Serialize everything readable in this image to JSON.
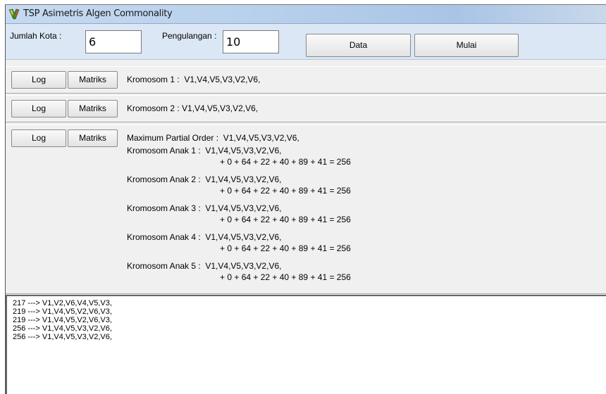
{
  "window": {
    "title": "TSP Asimetris Algen Commonality"
  },
  "topbar": {
    "jumlah_kota_label": "Jumlah Kota :",
    "jumlah_kota_value": "6",
    "pengulangan_label": "Pengulangan :",
    "pengulangan_value": "10",
    "data_button": "Data",
    "mulai_button": "Mulai"
  },
  "buttons": {
    "log": "Log",
    "matriks": "Matriks"
  },
  "kromosom1": {
    "text": "Kromosom 1 :  V1,V4,V5,V3,V2,V6,"
  },
  "kromosom2": {
    "text": "Kromosom 2 : V1,V4,V5,V3,V2,V6,"
  },
  "result": {
    "mpo": "Maximum Partial Order :  V1,V4,V5,V3,V2,V6,",
    "anak": [
      {
        "label": "Kromosom Anak 1 :  V1,V4,V5,V3,V2,V6,",
        "calc": "+ 0 + 64 + 22 + 40 + 89 + 41 = 256"
      },
      {
        "label": "Kromosom Anak 2 :  V1,V4,V5,V3,V2,V6,",
        "calc": "+ 0 + 64 + 22 + 40 + 89 + 41 = 256"
      },
      {
        "label": "Kromosom Anak 3 :  V1,V4,V5,V3,V2,V6,",
        "calc": "+ 0 + 64 + 22 + 40 + 89 + 41 = 256"
      },
      {
        "label": "Kromosom Anak 4 :  V1,V4,V5,V3,V2,V6,",
        "calc": "+ 0 + 64 + 22 + 40 + 89 + 41 = 256"
      },
      {
        "label": "Kromosom Anak 5 :  V1,V4,V5,V3,V2,V6,",
        "calc": "+ 0 + 64 + 22 + 40 + 89 + 41 = 256"
      }
    ]
  },
  "log": [
    "217 ---> V1,V2,V6,V4,V5,V3,",
    "219 ---> V1,V4,V5,V2,V6,V3,",
    "219 ---> V1,V4,V5,V2,V6,V3,",
    "256 ---> V1,V4,V5,V3,V2,V6,",
    "256 ---> V1,V4,V5,V3,V2,V6,"
  ],
  "icons": {
    "app": "app-icon"
  }
}
